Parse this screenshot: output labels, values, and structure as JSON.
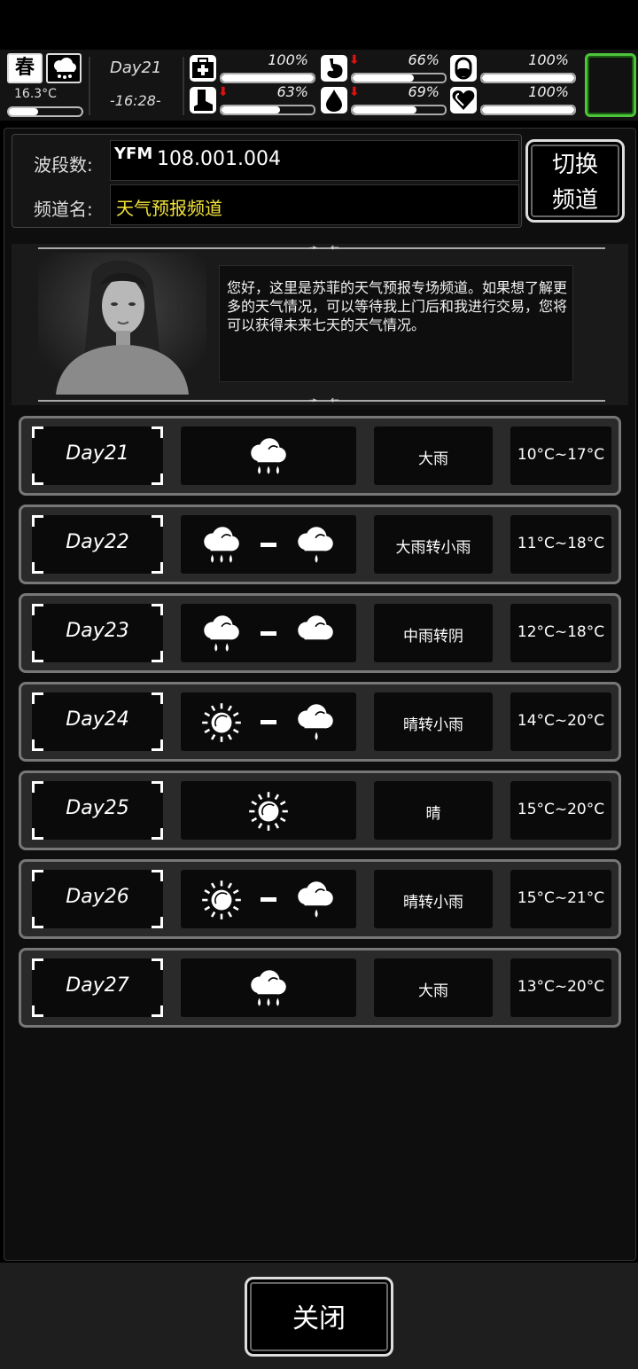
{
  "hud": {
    "season": "春",
    "weather_icon": "heavy-rain-icon",
    "temperature": "16.3°C",
    "temperature_level": 0.4,
    "day": "Day21",
    "time": "-16:28-",
    "stats": [
      {
        "name": "health",
        "icon": "medkit-icon",
        "value": "100%",
        "level": 1.0,
        "declining": false
      },
      {
        "name": "hunger",
        "icon": "stomach-icon",
        "value": "66%",
        "level": 0.66,
        "declining": true
      },
      {
        "name": "mood",
        "icon": "pill-icon",
        "value": "100%",
        "level": 1.0,
        "declining": false
      },
      {
        "name": "stamina",
        "icon": "boot-icon",
        "value": "63%",
        "level": 0.63,
        "declining": true
      },
      {
        "name": "thirst",
        "icon": "water-drop-icon",
        "value": "69%",
        "level": 0.69,
        "declining": true
      },
      {
        "name": "heart",
        "icon": "heart-icon",
        "value": "100%",
        "level": 1.0,
        "declining": false
      }
    ],
    "highlight_color": "#4fc33b"
  },
  "radio": {
    "band_label": "波段数:",
    "band_icon": "YFM",
    "band_value": "108.001.004",
    "channel_label": "频道名:",
    "channel_value": "天气预报频道",
    "switch_label_1": "切换",
    "switch_label_2": "频道"
  },
  "announcer": {
    "message": "您好，这里是苏菲的天气预报专场频道。如果想了解更多的天气情况，可以等待我上门后和我进行交易，您将可以获得未来七天的天气情况。"
  },
  "forecast": [
    {
      "day": "Day21",
      "icons": [
        "heavy-rain"
      ],
      "desc": "大雨",
      "temp": "10°C~17°C"
    },
    {
      "day": "Day22",
      "icons": [
        "heavy-rain",
        "light-rain"
      ],
      "desc": "大雨转小雨",
      "temp": "11°C~18°C"
    },
    {
      "day": "Day23",
      "icons": [
        "moderate-rain",
        "cloudy"
      ],
      "desc": "中雨转阴",
      "temp": "12°C~18°C"
    },
    {
      "day": "Day24",
      "icons": [
        "sunny",
        "light-rain"
      ],
      "desc": "晴转小雨",
      "temp": "14°C~20°C"
    },
    {
      "day": "Day25",
      "icons": [
        "sunny"
      ],
      "desc": "晴",
      "temp": "15°C~20°C"
    },
    {
      "day": "Day26",
      "icons": [
        "sunny",
        "light-rain"
      ],
      "desc": "晴转小雨",
      "temp": "15°C~21°C"
    },
    {
      "day": "Day27",
      "icons": [
        "heavy-rain"
      ],
      "desc": "大雨",
      "temp": "13°C~20°C"
    }
  ],
  "footer": {
    "close_label": "关闭"
  }
}
